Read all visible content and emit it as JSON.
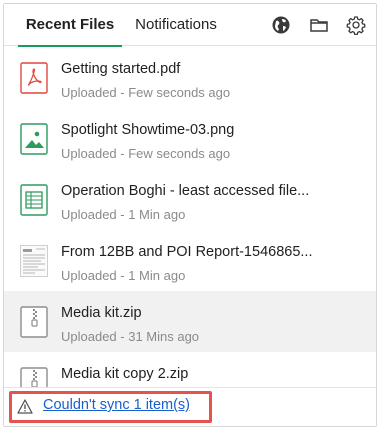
{
  "header": {
    "tabs": [
      {
        "label": "Recent Files",
        "active": true
      },
      {
        "label": "Notifications",
        "active": false
      }
    ],
    "icons": [
      "globe-icon",
      "folder-icon",
      "gear-icon"
    ]
  },
  "files": [
    {
      "name": "Getting started.pdf",
      "status": "Uploaded - Few seconds ago",
      "icon": "pdf-icon"
    },
    {
      "name": "Spotlight Showtime-03.png",
      "status": "Uploaded - Few seconds ago",
      "icon": "image-icon"
    },
    {
      "name": "Operation Boghi - least accessed file...",
      "status": "Uploaded - 1 Min ago",
      "icon": "spreadsheet-icon"
    },
    {
      "name": "From 12BB and POI Report-1546865...",
      "status": "Uploaded - 1 Min ago",
      "icon": "document-thumbnail-icon"
    },
    {
      "name": "Media kit.zip",
      "status": "Uploaded - 31 Mins ago",
      "icon": "zip-icon",
      "selected": true
    },
    {
      "name": "Media kit copy 2.zip",
      "status": "",
      "icon": "zip-icon"
    }
  ],
  "footer": {
    "sync_message": "Couldn't sync 1 item(s)",
    "warning_icon": "warning-icon"
  },
  "colors": {
    "accent": "#1a9b5c",
    "pdf": "#e0463e",
    "image": "#2e9a5e",
    "link": "#1a5fd0",
    "highlight_border": "#e6534e",
    "selected_row": "#f1f1f1"
  }
}
